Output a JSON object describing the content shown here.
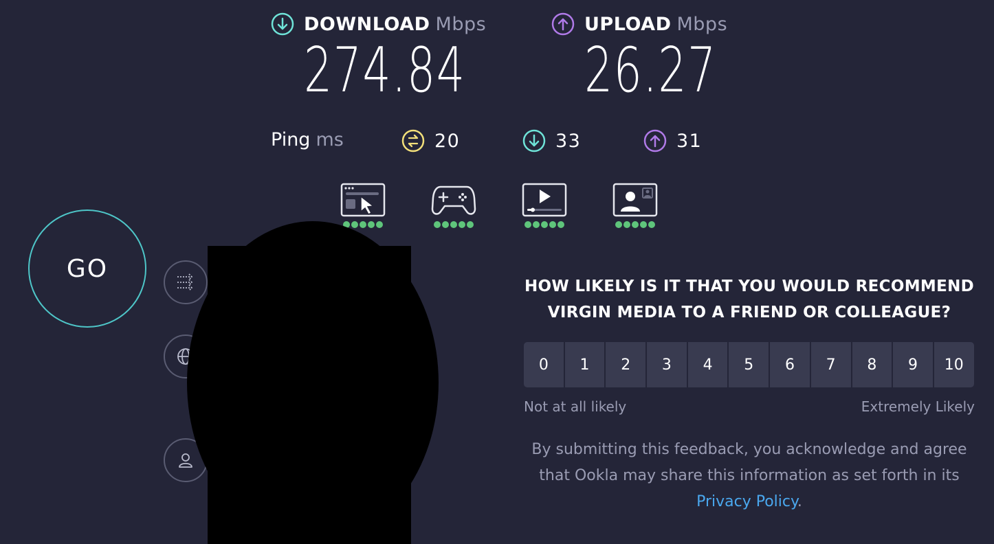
{
  "download": {
    "label": "DOWNLOAD",
    "unit": "Mbps",
    "value": "274.84"
  },
  "upload": {
    "label": "UPLOAD",
    "unit": "Mbps",
    "value": "26.27"
  },
  "ping": {
    "label": "Ping",
    "unit": "ms",
    "idle": "20",
    "download": "33",
    "upload": "31"
  },
  "use_cases": [
    {
      "icon": "web-browsing-icon",
      "rating": 5
    },
    {
      "icon": "gaming-icon",
      "rating": 5
    },
    {
      "icon": "streaming-icon",
      "rating": 5
    },
    {
      "icon": "video-chat-icon",
      "rating": 5
    }
  ],
  "go_button": "GO",
  "survey": {
    "question": "HOW LIKELY IS IT THAT YOU WOULD RECOMMEND VIRGIN MEDIA TO A FRIEND OR COLLEAGUE?",
    "scale": [
      "0",
      "1",
      "2",
      "3",
      "4",
      "5",
      "6",
      "7",
      "8",
      "9",
      "10"
    ],
    "low_label": "Not at all likely",
    "high_label": "Extremely Likely",
    "disclaimer_pre": "By submitting this feedback, you acknowledge and agree that Ookla may share this information as set forth in its ",
    "disclaimer_link": "Privacy Policy",
    "disclaimer_post": "."
  },
  "colors": {
    "background": "#242538",
    "download_accent": "#6fe3d8",
    "upload_accent": "#b07ae8",
    "ping_accent": "#f3e07a",
    "rating_dot": "#5fc57b",
    "go_border": "#4ec6c8",
    "link": "#4aa8ef"
  }
}
